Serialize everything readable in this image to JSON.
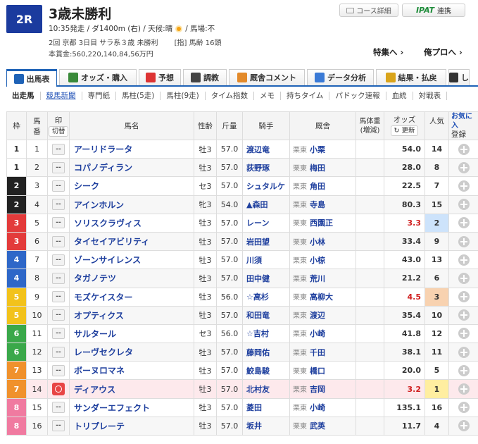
{
  "header": {
    "race_number": "2R",
    "title": "3歳未勝利",
    "info1_pre": "10:35発走 / ダ1400m (右) / 天候:晴",
    "info1_post": "/ 馬場:不",
    "info2": "2回 京都 3日目 サラ系３歳 未勝利　　 [指] 馬齢 16頭",
    "info3": "本賞金:560,220,140,84,56万円",
    "course_btn": "コース詳細",
    "ipat_logo": "IPAT",
    "ipat_btn": "連携",
    "special_link": "特集へ ›",
    "pro_link": "俺プロへ ›"
  },
  "main_tabs": [
    {
      "label": "出馬表",
      "icon": "table-icon",
      "color": "#1e62b6"
    },
    {
      "label": "オッズ・購入",
      "icon": "ticket-icon",
      "color": "#3a8a3a"
    },
    {
      "label": "予想",
      "icon": "target-icon",
      "color": "#d33"
    },
    {
      "label": "調教",
      "icon": "stopwatch-icon",
      "color": "#444"
    },
    {
      "label": "厩舎コメント",
      "icon": "stable-icon",
      "color": "#e38a2a"
    },
    {
      "label": "データ分析",
      "icon": "chart-icon",
      "color": "#3a7ad6"
    },
    {
      "label": "結果・払戻",
      "icon": "coin-icon",
      "color": "#d9a41a"
    },
    {
      "label": "し",
      "icon": "video-icon",
      "color": "#333"
    }
  ],
  "sub_tabs": [
    "出走馬",
    "競馬新聞",
    "専門紙",
    "馬柱(5走)",
    "馬柱(9走)",
    "タイム指数",
    "メモ",
    "持ちタイム",
    "パドック速報",
    "血統",
    "対戦表"
  ],
  "table": {
    "headers": {
      "waku": "枠",
      "umaban_1": "馬",
      "umaban_2": "番",
      "mark_1": "印",
      "mark_btn": "切替",
      "name": "馬名",
      "sex": "性齢",
      "weight": "斤量",
      "jockey": "騎手",
      "trainer": "厩舎",
      "body_1": "馬体重",
      "body_2": "(増減)",
      "odds": "オッズ",
      "odds_btn": "更新",
      "pop": "人気",
      "fav": "お気に入",
      "fav_btn": "登録"
    },
    "rows": [
      {
        "waku": "1",
        "num": "1",
        "mark": "--",
        "name": "アーリドラータ",
        "sex": "牡3",
        "weight": "57.0",
        "jockey": "渡辺竜",
        "region": "栗東",
        "trainer": "小栗",
        "odds": "54.0",
        "pop": "14"
      },
      {
        "waku": "1",
        "num": "2",
        "mark": "--",
        "name": "コパノディラン",
        "sex": "牡3",
        "weight": "57.0",
        "jockey": "荻野琢",
        "region": "栗東",
        "trainer": "梅田",
        "odds": "28.0",
        "pop": "8"
      },
      {
        "waku": "2",
        "num": "3",
        "mark": "--",
        "name": "シーク",
        "sex": "セ3",
        "weight": "57.0",
        "jockey": "シュタルケ",
        "region": "栗東",
        "trainer": "角田",
        "odds": "22.5",
        "pop": "7"
      },
      {
        "waku": "2",
        "num": "4",
        "mark": "--",
        "name": "アインホルン",
        "sex": "牝3",
        "weight": "54.0",
        "jockey": "▲森田",
        "region": "栗東",
        "trainer": "寺島",
        "odds": "80.3",
        "pop": "15"
      },
      {
        "waku": "3",
        "num": "5",
        "mark": "--",
        "name": "ソリスクラヴィス",
        "sex": "牡3",
        "weight": "57.0",
        "jockey": "レーン",
        "region": "栗東",
        "trainer": "西園正",
        "odds": "3.3",
        "pop": "2"
      },
      {
        "waku": "3",
        "num": "6",
        "mark": "--",
        "name": "タイセイアビリティ",
        "sex": "牡3",
        "weight": "57.0",
        "jockey": "岩田望",
        "region": "栗東",
        "trainer": "小林",
        "odds": "33.4",
        "pop": "9"
      },
      {
        "waku": "4",
        "num": "7",
        "mark": "--",
        "name": "ゾーンサイレンス",
        "sex": "牡3",
        "weight": "57.0",
        "jockey": "川須",
        "region": "栗東",
        "trainer": "小椋",
        "odds": "43.0",
        "pop": "13"
      },
      {
        "waku": "4",
        "num": "8",
        "mark": "--",
        "name": "タガノテツ",
        "sex": "牡3",
        "weight": "57.0",
        "jockey": "田中健",
        "region": "栗東",
        "trainer": "荒川",
        "odds": "21.2",
        "pop": "6"
      },
      {
        "waku": "5",
        "num": "9",
        "mark": "--",
        "name": "モズケイスター",
        "sex": "牡3",
        "weight": "56.0",
        "jockey": "☆高杉",
        "region": "栗東",
        "trainer": "高柳大",
        "odds": "4.5",
        "pop": "3"
      },
      {
        "waku": "5",
        "num": "10",
        "mark": "--",
        "name": "オプティクス",
        "sex": "牡3",
        "weight": "57.0",
        "jockey": "和田竜",
        "region": "栗東",
        "trainer": "渡辺",
        "odds": "35.4",
        "pop": "10"
      },
      {
        "waku": "6",
        "num": "11",
        "mark": "--",
        "name": "サルタール",
        "sex": "セ3",
        "weight": "56.0",
        "jockey": "☆吉村",
        "region": "栗東",
        "trainer": "小崎",
        "odds": "41.8",
        "pop": "12"
      },
      {
        "waku": "6",
        "num": "12",
        "mark": "--",
        "name": "レーヴセクレタ",
        "sex": "牡3",
        "weight": "57.0",
        "jockey": "藤岡佑",
        "region": "栗東",
        "trainer": "千田",
        "odds": "38.1",
        "pop": "11"
      },
      {
        "waku": "7",
        "num": "13",
        "mark": "--",
        "name": "ボーヌロマネ",
        "sex": "牡3",
        "weight": "57.0",
        "jockey": "鮫島駿",
        "region": "栗東",
        "trainer": "橋口",
        "odds": "20.0",
        "pop": "5"
      },
      {
        "waku": "7",
        "num": "14",
        "mark": "◎",
        "name": "ディアウス",
        "sex": "牡3",
        "weight": "57.0",
        "jockey": "北村友",
        "region": "栗東",
        "trainer": "吉岡",
        "odds": "3.2",
        "pop": "1"
      },
      {
        "waku": "8",
        "num": "15",
        "mark": "--",
        "name": "サンダーエフェクト",
        "sex": "牡3",
        "weight": "57.0",
        "jockey": "菱田",
        "region": "栗東",
        "trainer": "小崎",
        "odds": "135.1",
        "pop": "16"
      },
      {
        "waku": "8",
        "num": "16",
        "mark": "--",
        "name": "トリプレーテ",
        "sex": "牡3",
        "weight": "57.0",
        "jockey": "坂井",
        "region": "栗東",
        "trainer": "武英",
        "odds": "11.7",
        "pop": "4"
      }
    ]
  },
  "colors": {
    "waku": {
      "1": "#ffffff",
      "2": "#222222",
      "3": "#e33b3b",
      "4": "#2e67c8",
      "5": "#f2c21b",
      "6": "#3aa84a",
      "7": "#f0912c",
      "8": "#f07aa0"
    },
    "accent": "#1e62b6"
  }
}
